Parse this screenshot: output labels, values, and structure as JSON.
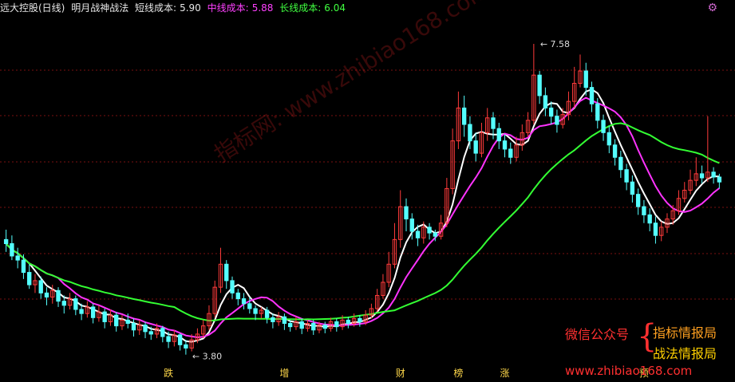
{
  "header": {
    "title": "远大控股(日线)",
    "indicator": "明月战神战法",
    "short_label": "短线成本:",
    "short_value": "5.90",
    "mid_label": "中线成本:",
    "mid_value": "5.88",
    "long_label": "长线成本:",
    "long_value": "6.04"
  },
  "watermark": "指标网: www.zhibiao168.com",
  "ad": {
    "wechat": "微信公众号",
    "brace": "{",
    "name1": "指标情报局",
    "name2": "战法情报局",
    "site": "www.zhibiao168.com"
  },
  "chart_data": {
    "type": "candlestick",
    "high_label": "7.58",
    "low_label": "3.80",
    "price_range": [
      3.7,
      7.9
    ],
    "candles": [
      [
        5.2,
        5.15,
        5.32,
        5.05
      ],
      [
        5.15,
        5.0,
        5.25,
        4.95
      ],
      [
        5.0,
        4.95,
        5.1,
        4.85
      ],
      [
        4.95,
        4.8,
        5.02,
        4.72
      ],
      [
        4.8,
        4.65,
        4.9,
        4.6
      ],
      [
        4.65,
        4.7,
        4.78,
        4.55
      ],
      [
        4.7,
        4.55,
        4.75,
        4.48
      ],
      [
        4.55,
        4.5,
        4.62,
        4.4
      ],
      [
        4.5,
        4.58,
        4.65,
        4.42
      ],
      [
        4.58,
        4.45,
        4.62,
        4.38
      ],
      [
        4.45,
        4.4,
        4.52,
        4.3
      ],
      [
        4.4,
        4.48,
        4.55,
        4.35
      ],
      [
        4.48,
        4.35,
        4.52,
        4.28
      ],
      [
        4.35,
        4.3,
        4.42,
        4.22
      ],
      [
        4.3,
        4.38,
        4.45,
        4.25
      ],
      [
        4.38,
        4.25,
        4.42,
        4.18
      ],
      [
        4.25,
        4.32,
        4.4,
        4.2
      ],
      [
        4.32,
        4.2,
        4.36,
        4.12
      ],
      [
        4.2,
        4.28,
        4.35,
        4.15
      ],
      [
        4.28,
        4.15,
        4.32,
        4.08
      ],
      [
        4.15,
        4.22,
        4.28,
        4.1
      ],
      [
        4.22,
        4.18,
        4.3,
        4.12
      ],
      [
        4.18,
        4.1,
        4.24,
        4.02
      ],
      [
        4.1,
        4.16,
        4.22,
        4.04
      ],
      [
        4.16,
        4.08,
        4.2,
        4.0
      ],
      [
        4.08,
        4.05,
        4.14,
        3.98
      ],
      [
        4.05,
        4.12,
        4.18,
        4.0
      ],
      [
        4.12,
        4.02,
        4.15,
        3.95
      ],
      [
        4.02,
        3.96,
        4.08,
        3.88
      ],
      [
        3.96,
        4.04,
        4.1,
        3.9
      ],
      [
        4.04,
        3.92,
        4.06,
        3.85
      ],
      [
        3.92,
        3.88,
        3.98,
        3.8
      ],
      [
        3.88,
        3.98,
        4.05,
        3.84
      ],
      [
        3.98,
        4.05,
        4.12,
        3.94
      ],
      [
        4.05,
        4.15,
        4.22,
        4.0
      ],
      [
        4.15,
        4.3,
        4.4,
        4.1
      ],
      [
        4.3,
        4.62,
        4.7,
        4.25
      ],
      [
        4.62,
        4.9,
        5.1,
        4.55
      ],
      [
        4.9,
        4.7,
        4.95,
        4.6
      ],
      [
        4.7,
        4.55,
        4.75,
        4.48
      ],
      [
        4.55,
        4.48,
        4.6,
        4.4
      ],
      [
        4.48,
        4.42,
        4.55,
        4.35
      ],
      [
        4.42,
        4.36,
        4.5,
        4.3
      ],
      [
        4.36,
        4.3,
        4.4,
        4.22
      ],
      [
        4.3,
        4.34,
        4.38,
        4.24
      ],
      [
        4.34,
        4.25,
        4.38,
        4.18
      ],
      [
        4.25,
        4.2,
        4.3,
        4.12
      ],
      [
        4.2,
        4.26,
        4.32,
        4.15
      ],
      [
        4.26,
        4.18,
        4.3,
        4.1
      ],
      [
        4.18,
        4.14,
        4.22,
        4.08
      ],
      [
        4.14,
        4.2,
        4.26,
        4.1
      ],
      [
        4.2,
        4.12,
        4.24,
        4.05
      ],
      [
        4.12,
        4.18,
        4.22,
        4.08
      ],
      [
        4.18,
        4.1,
        4.22,
        4.04
      ],
      [
        4.1,
        4.16,
        4.2,
        4.06
      ],
      [
        4.16,
        4.12,
        4.2,
        4.06
      ],
      [
        4.12,
        4.2,
        4.25,
        4.08
      ],
      [
        4.2,
        4.14,
        4.24,
        4.08
      ],
      [
        4.14,
        4.22,
        4.28,
        4.1
      ],
      [
        4.22,
        4.18,
        4.26,
        4.12
      ],
      [
        4.18,
        4.24,
        4.3,
        4.14
      ],
      [
        4.24,
        4.2,
        4.28,
        4.14
      ],
      [
        4.2,
        4.28,
        4.34,
        4.16
      ],
      [
        4.28,
        4.36,
        4.42,
        4.24
      ],
      [
        4.36,
        4.52,
        4.6,
        4.32
      ],
      [
        4.52,
        4.68,
        4.78,
        4.48
      ],
      [
        4.68,
        4.9,
        5.05,
        4.62
      ],
      [
        4.9,
        5.2,
        5.4,
        4.85
      ],
      [
        5.2,
        5.6,
        5.8,
        5.1
      ],
      [
        5.6,
        5.45,
        5.7,
        5.3
      ],
      [
        5.45,
        5.3,
        5.52,
        5.2
      ],
      [
        5.3,
        5.22,
        5.38,
        5.12
      ],
      [
        5.22,
        5.35,
        5.42,
        5.15
      ],
      [
        5.35,
        5.28,
        5.4,
        5.2
      ],
      [
        5.28,
        5.24,
        5.32,
        5.18
      ],
      [
        5.24,
        5.4,
        5.5,
        5.2
      ],
      [
        5.4,
        5.82,
        5.95,
        5.35
      ],
      [
        5.82,
        6.4,
        6.55,
        5.75
      ],
      [
        6.4,
        6.8,
        7.0,
        6.3
      ],
      [
        6.8,
        6.6,
        6.95,
        6.45
      ],
      [
        6.6,
        6.4,
        6.7,
        6.3
      ],
      [
        6.4,
        6.25,
        6.5,
        6.15
      ],
      [
        6.25,
        6.5,
        6.62,
        6.2
      ],
      [
        6.5,
        6.68,
        6.8,
        6.4
      ],
      [
        6.68,
        6.55,
        6.75,
        6.42
      ],
      [
        6.55,
        6.4,
        6.62,
        6.3
      ],
      [
        6.4,
        6.3,
        6.48,
        6.2
      ],
      [
        6.3,
        6.2,
        6.38,
        6.12
      ],
      [
        6.2,
        6.35,
        6.45,
        6.15
      ],
      [
        6.35,
        6.5,
        6.6,
        6.28
      ],
      [
        6.5,
        6.65,
        6.75,
        6.45
      ],
      [
        6.65,
        7.2,
        7.58,
        6.6
      ],
      [
        7.2,
        6.95,
        7.25,
        6.85
      ],
      [
        6.95,
        6.8,
        7.05,
        6.7
      ],
      [
        6.8,
        6.7,
        6.88,
        6.6
      ],
      [
        6.7,
        6.6,
        6.78,
        6.5
      ],
      [
        6.6,
        6.72,
        6.8,
        6.55
      ],
      [
        6.72,
        6.88,
        7.0,
        6.65
      ],
      [
        6.88,
        7.1,
        7.3,
        6.8
      ],
      [
        7.1,
        7.25,
        7.45,
        7.05
      ],
      [
        7.25,
        7.05,
        7.35,
        6.95
      ],
      [
        7.05,
        6.85,
        7.12,
        6.75
      ],
      [
        6.85,
        6.65,
        6.92,
        6.55
      ],
      [
        6.65,
        6.5,
        6.72,
        6.4
      ],
      [
        6.5,
        6.35,
        6.58,
        6.25
      ],
      [
        6.35,
        6.2,
        6.42,
        6.1
      ],
      [
        6.2,
        6.05,
        6.28,
        5.95
      ],
      [
        6.05,
        5.9,
        6.12,
        5.8
      ],
      [
        5.9,
        5.75,
        5.98,
        5.65
      ],
      [
        5.75,
        5.6,
        5.82,
        5.5
      ],
      [
        5.6,
        5.5,
        5.68,
        5.4
      ],
      [
        5.5,
        5.4,
        5.58,
        5.3
      ],
      [
        5.4,
        5.25,
        5.48,
        5.15
      ],
      [
        5.25,
        5.35,
        5.42,
        5.18
      ],
      [
        5.35,
        5.45,
        5.52,
        5.28
      ],
      [
        5.45,
        5.55,
        5.62,
        5.38
      ],
      [
        5.55,
        5.7,
        5.8,
        5.5
      ],
      [
        5.7,
        5.8,
        5.9,
        5.65
      ],
      [
        5.8,
        5.92,
        6.05,
        5.75
      ],
      [
        5.92,
        6.0,
        6.2,
        5.85
      ],
      [
        6.0,
        5.95,
        6.1,
        5.88
      ],
      [
        5.95,
        6.02,
        6.7,
        5.9
      ],
      [
        6.02,
        5.96,
        6.08,
        5.88
      ],
      [
        5.96,
        5.9,
        6.0,
        5.82
      ]
    ],
    "markers": [
      {
        "i": 28,
        "t": "跌"
      },
      {
        "i": 48,
        "t": "增"
      },
      {
        "i": 68,
        "t": "财"
      },
      {
        "i": 78,
        "t": "榜"
      },
      {
        "i": 86,
        "t": "涨"
      },
      {
        "i": 110,
        "t": "预"
      }
    ]
  }
}
